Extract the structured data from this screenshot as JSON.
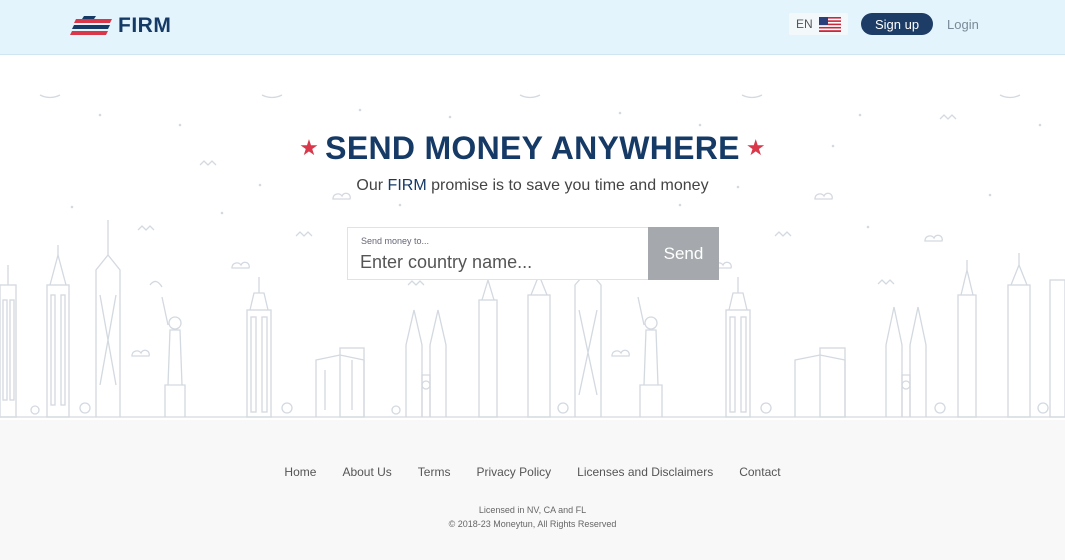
{
  "header": {
    "brand": "FIRM",
    "language": "EN",
    "signup_label": "Sign up",
    "login_label": "Login"
  },
  "hero": {
    "title": "SEND MONEY ANYWHERE",
    "subtitle_prefix": "Our ",
    "subtitle_brand": "FIRM",
    "subtitle_suffix": " promise is to save you time and money",
    "search_label": "Send money to...",
    "search_placeholder": "Enter country name...",
    "search_value": "",
    "send_label": "Send"
  },
  "footer": {
    "nav": [
      "Home",
      "About Us",
      "Terms",
      "Privacy Policy",
      "Licenses and Disclaimers",
      "Contact"
    ],
    "license": "Licensed in NV, CA and FL",
    "copyright": "© 2018-23 Moneytun, All Rights Reserved"
  },
  "colors": {
    "brand_navy": "#163a66",
    "accent_red": "#d9384a",
    "header_bg": "#e4f4fc",
    "send_button": "#a5a9ad",
    "skyline_line": "#d3d9e0"
  },
  "icons": {
    "logo": "flag-stripes-logo-icon",
    "flag": "us-flag-icon",
    "star": "star-icon"
  }
}
